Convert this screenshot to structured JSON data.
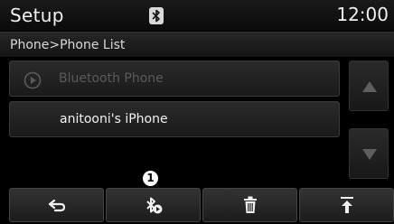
{
  "header": {
    "title": "Setup",
    "clock": "12:00"
  },
  "breadcrumb": "Phone>Phone List",
  "list": {
    "items": [
      {
        "label": "Bluetooth Phone",
        "icon": "play-circle-icon",
        "enabled": false
      },
      {
        "label": "anitooni's iPhone",
        "enabled": true
      }
    ]
  },
  "bottombar": {
    "buttons": [
      {
        "name": "back",
        "icon": "back-arrow-icon"
      },
      {
        "name": "bluetooth-connect",
        "icon": "bluetooth-connect-icon"
      },
      {
        "name": "delete",
        "icon": "trash-icon"
      },
      {
        "name": "top",
        "icon": "scroll-to-top-icon"
      }
    ]
  },
  "callout": "1",
  "colors": {
    "background": "#000000",
    "text": "#f0f0f0",
    "disabled_text": "#5a5a5a"
  }
}
